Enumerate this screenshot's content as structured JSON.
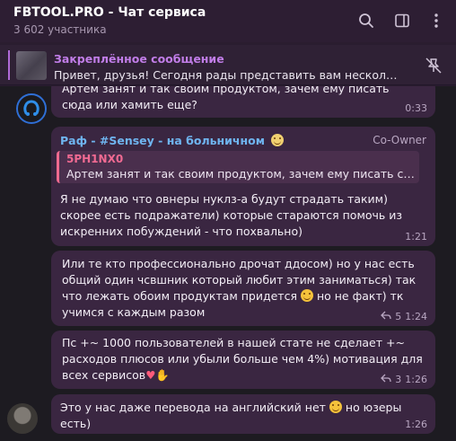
{
  "header": {
    "title": "FBTOOL.PRO - Чат сервиса",
    "members": "3 602 участника",
    "icons": [
      "search-icon",
      "sidebar-toggle-icon",
      "more-icon"
    ]
  },
  "pinned": {
    "label": "Закреплённое сообщение",
    "text": "Привет, друзья! Сегодня рады представить вам несколько н...",
    "icon": "unpin-icon"
  },
  "messages": [
    {
      "text": "Артем занят и так своим продуктом, зачем ему писать сюда или хамить еще?",
      "time": "0:33"
    },
    {
      "sender": "Раф - #Sensey - на больничном",
      "role": "Co-Owner",
      "reply_name": "5PH1NX0",
      "reply_text": "Артем занят и так своим продуктом, зачем ему писать сюда ...",
      "text": "Я не думаю что овнеры нуклз-а будут страдать таким) скорее есть подражатели) которые стараются помочь из искренних побуждений - что похвально)",
      "time": "1:21"
    },
    {
      "text_before": "Или те кто профессионально дрочат ддосом) но у нас есть общий один чсвшник который любит этим заниматься) так что лежать обоим продуктам придется",
      "text_after": "но не факт) тк учимся с каждым разом",
      "replies": "5",
      "time": "1:24"
    },
    {
      "text": "Пс +~ 1000 пользователей  в нашей стате не сделает +~ расходов плюсов или убыли больше чем 4%) мотивация для всех сервисов",
      "replies": "3",
      "time": "1:26"
    },
    {
      "text_before": "Это у нас даже перевода на английский нет",
      "text_after": "но юзеры есть)",
      "time": "1:26"
    }
  ]
}
